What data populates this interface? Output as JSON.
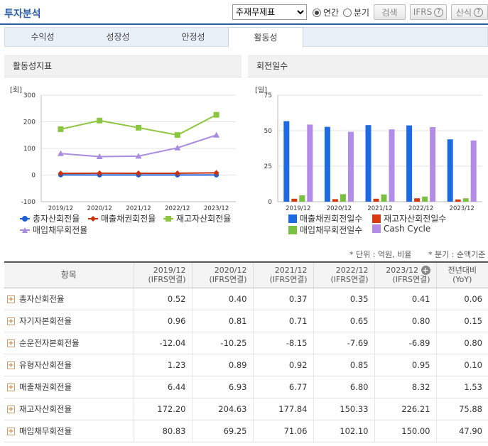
{
  "header": {
    "title": "투자분석",
    "select_value": "주재무제표",
    "radio_annual": "연간",
    "radio_quarter": "분기",
    "search_label": "검색",
    "ifrs_label": "IFRS",
    "calc_label": "산식"
  },
  "tabs": [
    "수익성",
    "성장성",
    "안정성",
    "활동성"
  ],
  "left_panel": {
    "title": "활동성지표",
    "unit": "[회]"
  },
  "right_panel": {
    "title": "회전일수",
    "unit": "[일]"
  },
  "chart_data": [
    {
      "type": "line",
      "title": "활동성지표",
      "ylabel": "[회]",
      "x": [
        "2019/12",
        "2020/12",
        "2021/12",
        "2022/12",
        "2023/12"
      ],
      "yticks": [
        "300",
        "200",
        "100",
        "0",
        "-100"
      ],
      "ylim": [
        -100,
        300
      ],
      "series": [
        {
          "name": "총자산회전율",
          "color": "#1f5fd6",
          "marker": "circle",
          "values": [
            0.52,
            0.4,
            0.37,
            0.35,
            0.41
          ]
        },
        {
          "name": "매출채권회전율",
          "color": "#c8320c",
          "marker": "diamond",
          "values": [
            6.44,
            6.93,
            6.77,
            6.8,
            8.32
          ]
        },
        {
          "name": "재고자산회전율",
          "color": "#8cc63f",
          "marker": "square",
          "values": [
            172.2,
            204.63,
            177.84,
            150.33,
            226.21
          ]
        },
        {
          "name": "매입채무회전율",
          "color": "#a98be0",
          "marker": "triangle",
          "values": [
            80.83,
            69.25,
            71.06,
            102.1,
            150.0
          ]
        }
      ]
    },
    {
      "type": "bar",
      "title": "회전일수",
      "ylabel": "[일]",
      "categories": [
        "2019/12",
        "2020/12",
        "2021/12",
        "2022/12",
        "2023/12"
      ],
      "yticks": [
        "75",
        "50",
        "25",
        "0"
      ],
      "ylim": [
        0,
        75
      ],
      "series": [
        {
          "name": "매출채권회전일수",
          "color": "#1e6ae0",
          "values": [
            56.7,
            52.7,
            53.9,
            53.7,
            43.9
          ]
        },
        {
          "name": "재고자산회전일수",
          "color": "#d63a10",
          "values": [
            2.1,
            1.8,
            2.1,
            2.4,
            1.6
          ]
        },
        {
          "name": "매입채무회전일수",
          "color": "#7ac143",
          "values": [
            4.5,
            5.3,
            5.1,
            3.6,
            2.4
          ]
        },
        {
          "name": "Cash Cycle",
          "color": "#b28ce6",
          "values": [
            54.3,
            49.2,
            50.9,
            52.5,
            43.1
          ]
        }
      ]
    }
  ],
  "notes": {
    "unit": "* 단위 : 억원, 비율",
    "quarter": "* 분기 : 순액기준"
  },
  "table": {
    "headers": [
      {
        "top": "항목",
        "bottom": ""
      },
      {
        "top": "2019/12",
        "bottom": "(IFRS연결)"
      },
      {
        "top": "2020/12",
        "bottom": "(IFRS연결)"
      },
      {
        "top": "2021/12",
        "bottom": "(IFRS연결)"
      },
      {
        "top": "2022/12",
        "bottom": "(IFRS연결)"
      },
      {
        "top": "2023/12",
        "bottom": "(IFRS연결)"
      },
      {
        "top": "전년대비",
        "bottom": "(YoY)"
      }
    ],
    "rows": [
      {
        "label": "총자산회전율",
        "values": [
          "0.52",
          "0.40",
          "0.37",
          "0.35",
          "0.41",
          "0.06"
        ]
      },
      {
        "label": "자기자본회전율",
        "values": [
          "0.96",
          "0.81",
          "0.71",
          "0.65",
          "0.80",
          "0.15"
        ]
      },
      {
        "label": "순운전자본회전율",
        "values": [
          "-12.04",
          "-10.25",
          "-8.15",
          "-7.69",
          "-6.89",
          "0.80"
        ]
      },
      {
        "label": "유형자산회전율",
        "values": [
          "1.23",
          "0.89",
          "0.92",
          "0.85",
          "0.95",
          "0.10"
        ]
      },
      {
        "label": "매출채권회전율",
        "values": [
          "6.44",
          "6.93",
          "6.77",
          "6.80",
          "8.32",
          "1.53"
        ]
      },
      {
        "label": "재고자산회전율",
        "values": [
          "172.20",
          "204.63",
          "177.84",
          "150.33",
          "226.21",
          "75.88"
        ]
      },
      {
        "label": "매입채무회전율",
        "values": [
          "80.83",
          "69.25",
          "71.06",
          "102.10",
          "150.00",
          "47.90"
        ]
      }
    ]
  }
}
